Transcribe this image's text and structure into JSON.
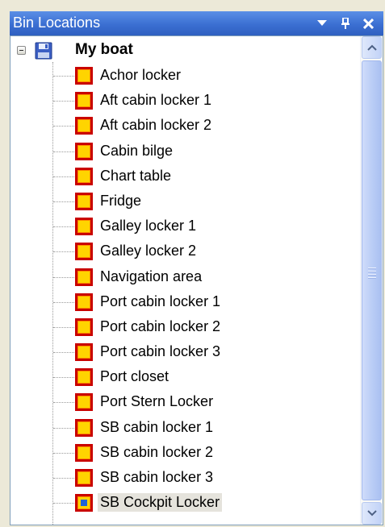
{
  "panel": {
    "title": "Bin Locations",
    "buttons": [
      {
        "name": "dropdown",
        "icon": "triangle-down-icon"
      },
      {
        "name": "pin",
        "icon": "pin-icon"
      },
      {
        "name": "close",
        "icon": "close-icon"
      }
    ]
  },
  "tree": {
    "root": {
      "label": "My boat",
      "icon": "floppy-disk-icon",
      "expanded": true
    },
    "items": [
      {
        "label": "Achor locker"
      },
      {
        "label": "Aft cabin locker 1"
      },
      {
        "label": "Aft cabin locker 2"
      },
      {
        "label": "Cabin bilge"
      },
      {
        "label": "Chart table"
      },
      {
        "label": "Fridge"
      },
      {
        "label": "Galley locker 1"
      },
      {
        "label": "Galley locker 2"
      },
      {
        "label": "Navigation area"
      },
      {
        "label": "Port cabin locker 1"
      },
      {
        "label": "Port cabin locker 2"
      },
      {
        "label": "Port cabin locker 3"
      },
      {
        "label": "Port closet"
      },
      {
        "label": "Port Stern Locker"
      },
      {
        "label": "SB cabin locker 1"
      },
      {
        "label": "SB cabin locker 2"
      },
      {
        "label": "SB cabin locker 3"
      },
      {
        "label": "SB Cockpit Locker",
        "selected": true
      }
    ]
  },
  "colors": {
    "titlebar": "#3b6fd2",
    "bin_border": "#c90000",
    "bin_fill": "#ffd400",
    "selected_marker": "#1f63d6"
  }
}
